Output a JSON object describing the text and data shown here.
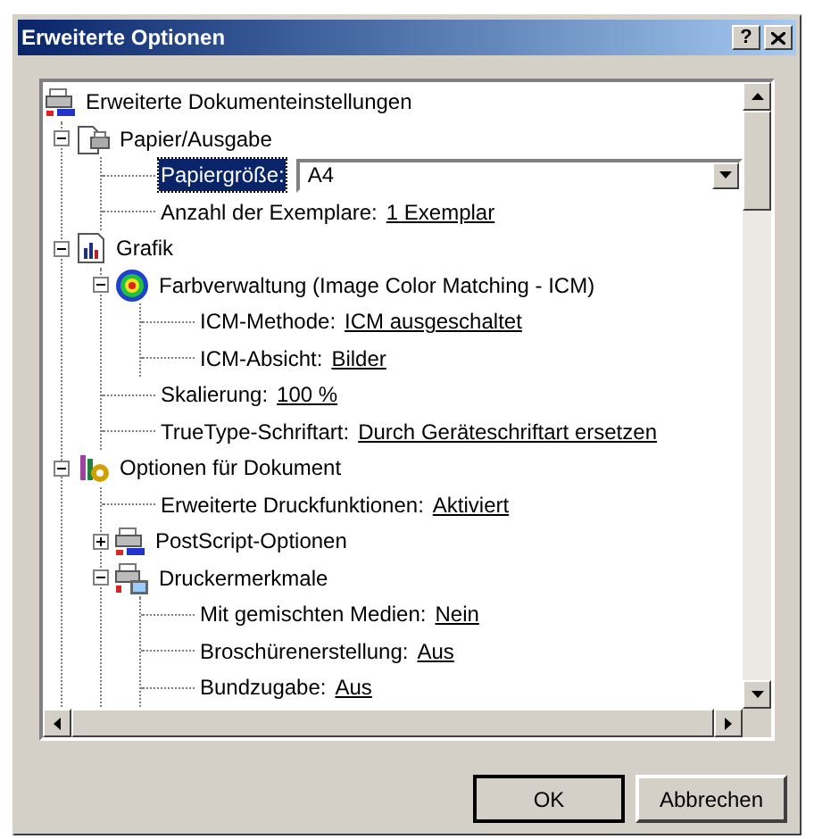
{
  "window": {
    "title": "Erweiterte Optionen",
    "help_button": "?"
  },
  "tree": [
    {
      "label": "Erweiterte Dokumenteinstellungen",
      "kind": "document",
      "selected": false,
      "children": [
        {
          "label": "Papier/Ausgabe",
          "kind": "paper",
          "selected": false,
          "expanded": true,
          "children": [
            {
              "label": "Papiergröße:",
              "kind": "combo",
              "value": "A4",
              "selected": true
            },
            {
              "label": "Anzahl der Exemplare:",
              "kind": "setting",
              "value": "1 Exemplar",
              "selected": false
            }
          ]
        },
        {
          "label": "Grafik",
          "kind": "graphics",
          "selected": false,
          "expanded": true,
          "children": [
            {
              "label": "Farbverwaltung (Image Color Matching - ICM)",
              "kind": "color",
              "selected": false,
              "expanded": true,
              "children": [
                {
                  "label": "ICM-Methode:",
                  "kind": "setting",
                  "value": "ICM ausgeschaltet",
                  "selected": false
                },
                {
                  "label": "ICM-Absicht:",
                  "kind": "setting",
                  "value": "Bilder",
                  "selected": false
                }
              ]
            },
            {
              "label": "Skalierung:",
              "kind": "setting",
              "value": "100 %",
              "selected": false
            },
            {
              "label": "TrueType-Schriftart:",
              "kind": "setting",
              "value": "Durch Geräteschriftart ersetzen",
              "selected": false
            }
          ]
        },
        {
          "label": "Optionen für Dokument",
          "kind": "options",
          "selected": false,
          "expanded": true,
          "children": [
            {
              "label": "Erweiterte Druckfunktionen:",
              "kind": "setting",
              "value": "Aktiviert",
              "selected": false
            },
            {
              "label": "PostScript-Optionen",
              "kind": "postscript",
              "selected": false,
              "expanded": false
            },
            {
              "label": "Druckermerkmale",
              "kind": "features",
              "selected": false,
              "expanded": true,
              "children": [
                {
                  "label": "Mit gemischten Medien:",
                  "kind": "setting",
                  "value": "Nein",
                  "selected": false
                },
                {
                  "label": "Broschürenerstellung:",
                  "kind": "setting",
                  "value": "Aus",
                  "selected": false
                },
                {
                  "label": "Bundzugabe:",
                  "kind": "setting",
                  "value": "Aus",
                  "selected": false
                }
              ]
            }
          ]
        }
      ]
    }
  ],
  "buttons": [
    "OK",
    "Abbrechen"
  ]
}
